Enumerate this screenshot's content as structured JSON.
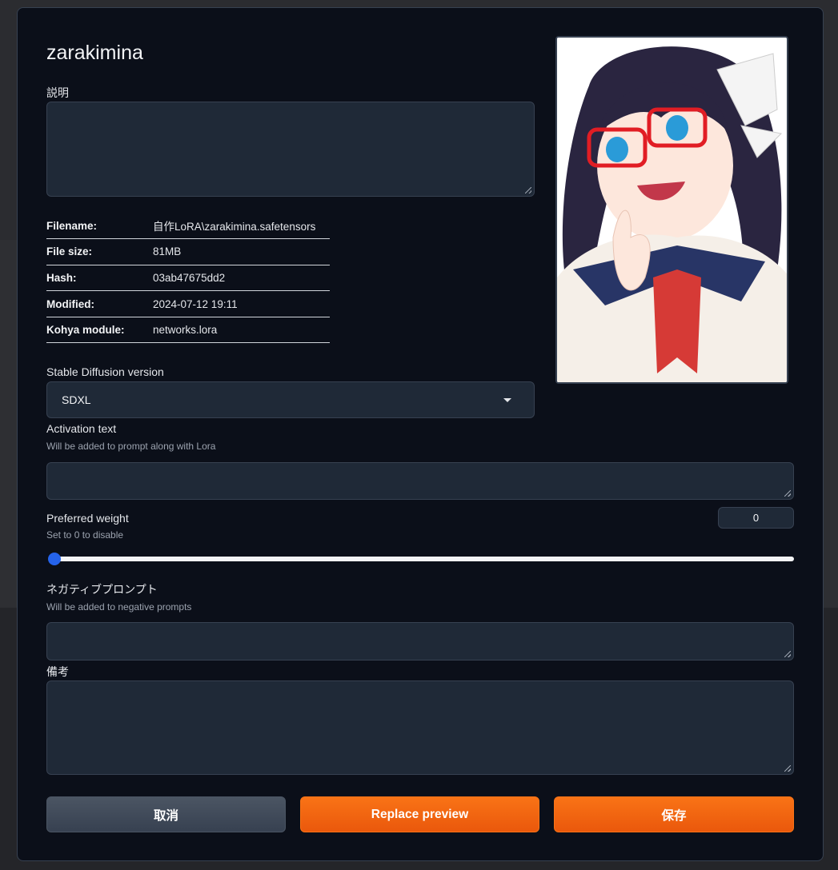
{
  "modal": {
    "title": "zarakimina",
    "description_label": "説明",
    "description_value": "",
    "info": [
      {
        "key": "Filename:",
        "value": "自作LoRA\\zarakimina.safetensors"
      },
      {
        "key": "File size:",
        "value": "81MB"
      },
      {
        "key": "Hash:",
        "value": "03ab47675dd2"
      },
      {
        "key": "Modified:",
        "value": "2024-07-12 19:11"
      },
      {
        "key": "Kohya module:",
        "value": "networks.lora"
      }
    ],
    "sd_version_label": "Stable Diffusion version",
    "sd_version_value": "SDXL",
    "activation_label": "Activation text",
    "activation_hint": "Will be added to prompt along with Lora",
    "activation_value": "",
    "weight_label": "Preferred weight",
    "weight_hint": "Set to 0 to disable",
    "weight_value": "0",
    "slider_fraction": 0,
    "negative_label": "ネガティブプロンプト",
    "negative_hint": "Will be added to negative prompts",
    "negative_value": "",
    "notes_label": "備考",
    "notes_value": "",
    "buttons": {
      "cancel": "取消",
      "replace_preview": "Replace preview",
      "save": "保存"
    }
  },
  "colors": {
    "accent": "#f97316",
    "slider_thumb": "#2563eb",
    "modal_bg": "#0b0f19",
    "field_bg": "#1f2937"
  }
}
